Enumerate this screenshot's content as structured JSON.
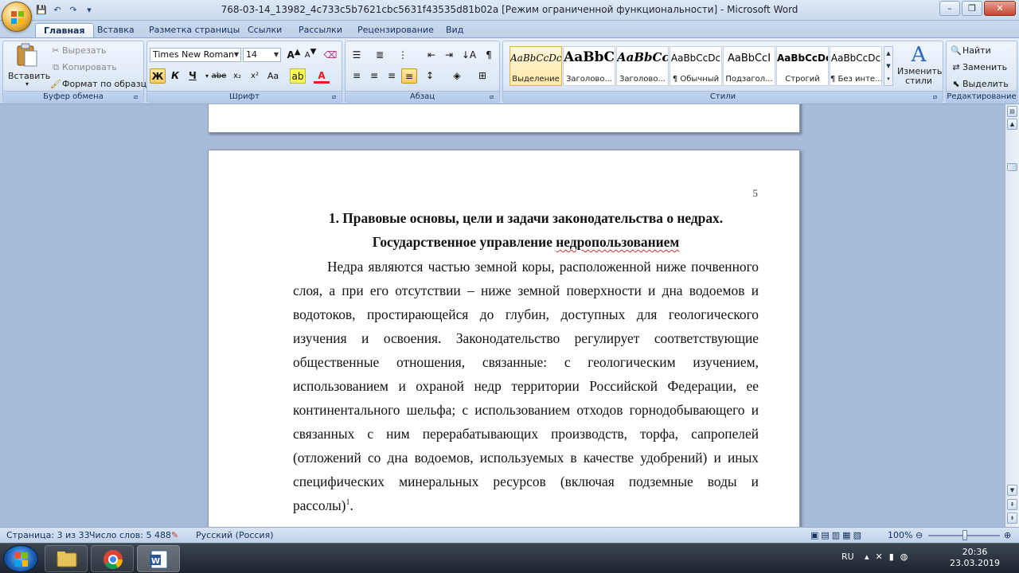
{
  "window": {
    "title": "768-03-14_13982_4c733c5b7621cbc5631f43535d81b02a [Режим ограниченной функциональности] - Microsoft Word"
  },
  "tabs": [
    "Главная",
    "Вставка",
    "Разметка страницы",
    "Ссылки",
    "Рассылки",
    "Рецензирование",
    "Вид"
  ],
  "ribbon": {
    "clipboard": {
      "paste": "Вставить",
      "cut": "Вырезать",
      "copy": "Копировать",
      "format_painter": "Формат по образцу",
      "label": "Буфер обмена"
    },
    "font": {
      "family": "Times New Roman",
      "size": "14",
      "label": "Шрифт",
      "bold": "Ж",
      "italic": "К",
      "underline": "Ч",
      "strike": "abe",
      "subscript": "x₂",
      "superscript": "x²",
      "case": "Aa",
      "grow": "A",
      "shrink": "A"
    },
    "paragraph": {
      "label": "Абзац"
    },
    "styles": {
      "label": "Стили",
      "items": [
        {
          "sample": "AaBbCcDc",
          "name": "Выделение"
        },
        {
          "sample": "AaBbC",
          "name": "Заголово..."
        },
        {
          "sample": "AaBbCc",
          "name": "Заголово..."
        },
        {
          "sample": "AaBbCcDc",
          "name": "¶ Обычный"
        },
        {
          "sample": "AaBbCcI",
          "name": "Подзагол..."
        },
        {
          "sample": "AaBbCcDc",
          "name": "Строгий"
        },
        {
          "sample": "AaBbCcDc",
          "name": "¶ Без инте..."
        }
      ],
      "change_styles": "Изменить стили"
    },
    "editing": {
      "label": "Редактирование",
      "find": "Найти",
      "replace": "Заменить",
      "select": "Выделить"
    }
  },
  "document": {
    "page_number": "5",
    "heading1": "1. Правовые основы, цели и задачи законодательства о недрах.",
    "heading2_prefix": "Государственное управление ",
    "heading2_word": "недропользованием",
    "lines": [
      "Недра являются частью земной коры, расположенной ниже почвенного",
      "слоя, а при его отсутствии – ниже земной поверхности и дна водоемов и",
      "водотоков, простирающейся до глубин, доступных для геологического",
      "изучения и освоения. Законодательство регулирует соответствующие",
      "общественные отношения, связанные: с геологическим изучением,",
      "использованием и охраной недр территории Российской Федерации, ее",
      "континентального шельфа; с использованием отходов горнодобывающего и",
      "связанных с ним перерабатывающих производств, торфа, сапропелей",
      "(отложений со дна водоемов, используемых в качестве удобрений) и иных",
      "специфических минеральных ресурсов (включая подземные воды и",
      "рассолы)"
    ],
    "footnote_ref": "1",
    "last_line_end": "."
  },
  "status": {
    "page": "Страница: 3 из 33",
    "words": "Число слов: 5 488",
    "language": "Русский (Россия)",
    "zoom": "100%"
  },
  "taskbar": {
    "lang": "RU",
    "time": "20:36",
    "date": "23.03.2019"
  },
  "colors": {
    "ribbon": "#dbe7f6",
    "doc_bg": "#a7bcd9",
    "accent": "#f8cb5b"
  }
}
